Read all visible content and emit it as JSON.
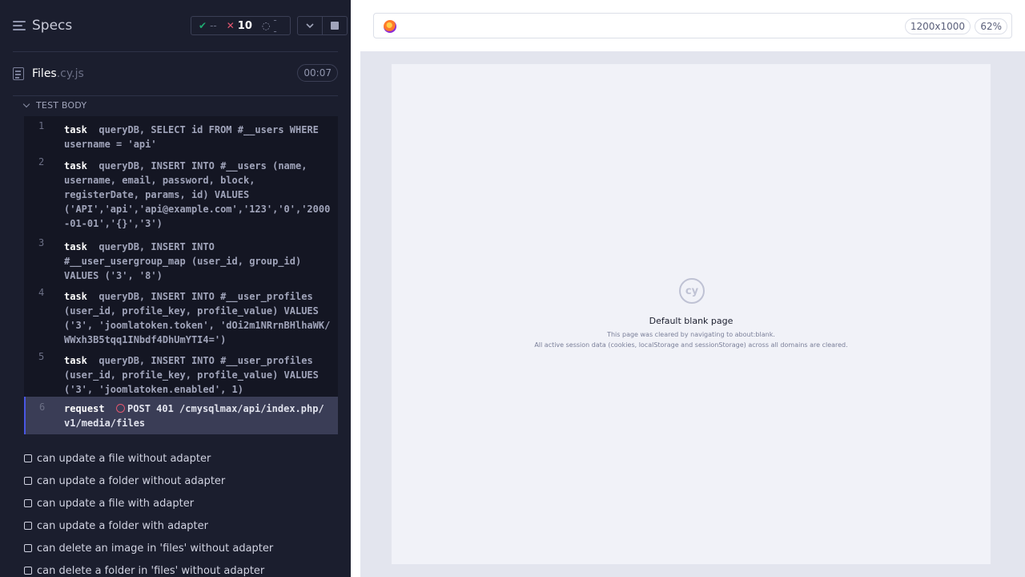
{
  "header": {
    "specs_label": "Specs",
    "stats": {
      "passed": "--",
      "failed": "10",
      "pending": "--"
    }
  },
  "spec": {
    "name": "Files",
    "ext": ".cy.js",
    "duration": "00:07"
  },
  "section_label": "TEST BODY",
  "commands": [
    {
      "num": "1",
      "name": "task",
      "text": "queryDB, SELECT id FROM #__users WHERE\nusername = 'api'"
    },
    {
      "num": "2",
      "name": "task",
      "text": "queryDB, INSERT INTO #__users (name,\nusername, email, password, block,\nregisterDate, params, id) VALUES\n('API','api','api@example.com','123','0','2000\n-01-01','{}','3')"
    },
    {
      "num": "3",
      "name": "task",
      "text": "queryDB, INSERT INTO\n#__user_usergroup_map (user_id, group_id)\nVALUES ('3', '8')"
    },
    {
      "num": "4",
      "name": "task",
      "text": "queryDB, INSERT INTO #__user_profiles\n(user_id, profile_key, profile_value) VALUES\n('3', 'joomlatoken.token', 'dOi2m1NRrnBHlhaWK/\nWWxh3B5tqq1INbdf4DhUmYTI4=')"
    },
    {
      "num": "5",
      "name": "task",
      "text": "queryDB, INSERT INTO #__user_profiles\n(user_id, profile_key, profile_value) VALUES\n('3', 'joomlatoken.enabled', 1)"
    }
  ],
  "active_command": {
    "num": "6",
    "name": "request",
    "text": "POST 401 /cmysqlmax/api/index.php/\nv1/media/files"
  },
  "tests": [
    "can update a file without adapter",
    "can update a folder without adapter",
    "can update a file with adapter",
    "can update a folder with adapter",
    "can delete an image in 'files' without adapter",
    "can delete a folder in 'files' without adapter"
  ],
  "aut": {
    "viewport": "1200x1000",
    "zoom": "62%",
    "logo_text": "cy",
    "blank_title": "Default blank page",
    "blank_desc_1": "This page was cleared by navigating to about:blank.",
    "blank_desc_2": "All active session data (cookies, localStorage and sessionStorage) across all domains are cleared."
  },
  "colors": {
    "passed": "#1fa971",
    "failed": "#e45770",
    "accent": "#4956e3",
    "panel": "#1b1e2e"
  }
}
